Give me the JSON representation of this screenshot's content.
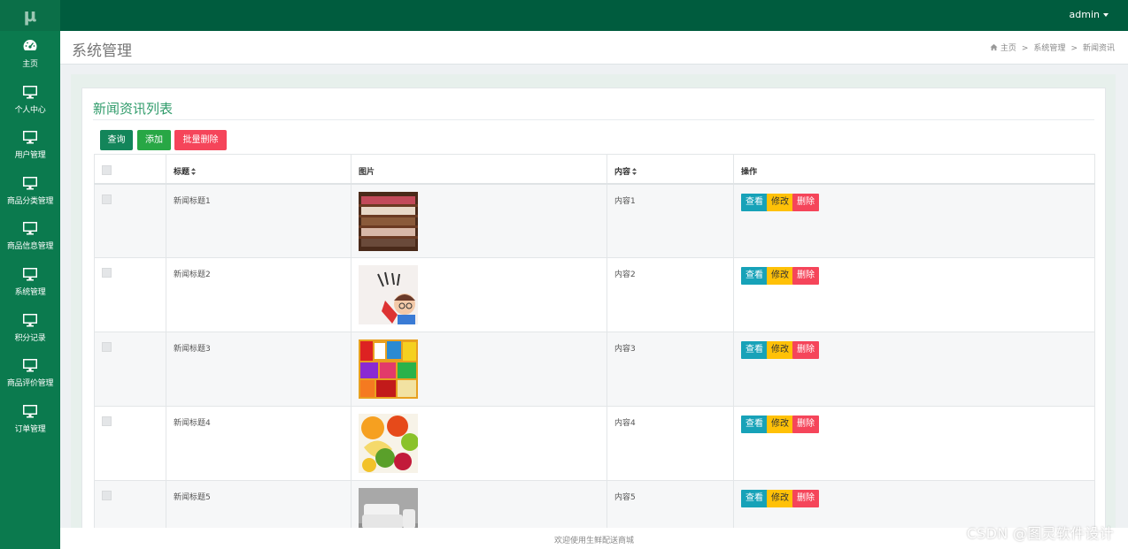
{
  "app": {
    "logo": "μ",
    "user": "admin"
  },
  "sidebar": {
    "items": [
      {
        "label": "主页",
        "icon": "dashboard-icon"
      },
      {
        "label": "个人中心",
        "icon": "monitor-icon"
      },
      {
        "label": "用户管理",
        "icon": "monitor-icon"
      },
      {
        "label": "商品分类管理",
        "icon": "monitor-icon"
      },
      {
        "label": "商品信息管理",
        "icon": "monitor-icon"
      },
      {
        "label": "系统管理",
        "icon": "monitor-icon"
      },
      {
        "label": "积分记录",
        "icon": "monitor-icon"
      },
      {
        "label": "商品评价管理",
        "icon": "monitor-icon"
      },
      {
        "label": "订单管理",
        "icon": "monitor-icon"
      }
    ]
  },
  "header": {
    "title": "系统管理",
    "breadcrumb": [
      "主页",
      "系统管理",
      "新闻资讯"
    ]
  },
  "panel": {
    "title": "新闻资讯列表",
    "buttons": {
      "search": "查询",
      "add": "添加",
      "batch_delete": "批量删除"
    },
    "columns": {
      "title": "标题",
      "image": "图片",
      "content": "内容",
      "actions": "操作"
    },
    "actions": {
      "view": "查看",
      "edit": "修改",
      "delete": "删除"
    },
    "rows": [
      {
        "title": "新闻标题1",
        "content": "内容1",
        "image": "shoe-rack"
      },
      {
        "title": "新闻标题2",
        "content": "内容2",
        "image": "cartoon-kid"
      },
      {
        "title": "新闻标题3",
        "content": "内容3",
        "image": "snacks"
      },
      {
        "title": "新闻标题4",
        "content": "内容4",
        "image": "fruits"
      },
      {
        "title": "新闻标题5",
        "content": "内容5",
        "image": "white-sofa"
      }
    ]
  },
  "footer": {
    "text": "欢迎使用生鲜配送商城"
  },
  "watermark": "CSDN @图灵软件设计",
  "colors": {
    "topbar": "#005c3e",
    "sidebar": "#0b7a4e",
    "title_green": "#2f9b6a",
    "view": "#17a2b8",
    "edit": "#ffc107",
    "delete": "#f5455a"
  }
}
